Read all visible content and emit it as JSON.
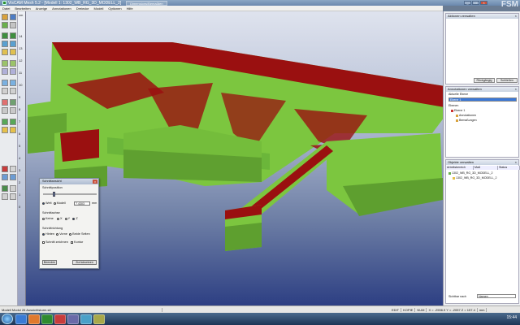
{
  "window": {
    "title": "VisCAM Mesh 5.2 - [Modell 1: 1302_WB_RG_3D_MODELL_2]",
    "tab_hint": "Dimensions/Bemaßten",
    "logo": "FSM"
  },
  "menu": [
    "Datei",
    "Bearbeiten",
    "Anzeige",
    "Annotationen",
    "Dreiecke",
    "Modell",
    "Optionen",
    "Hilfe"
  ],
  "ruler": {
    "unit": "cm",
    "ticks": [
      "14",
      "13",
      "12",
      "11",
      "10",
      "9",
      "8",
      "7",
      "6",
      "5",
      "4",
      "3",
      "2",
      "1",
      "0"
    ]
  },
  "section_dialog": {
    "title": "Schnittansicht",
    "position_label": "Schnittposition",
    "ref_welt": "Welt",
    "ref_modell": "Modell",
    "value": "7.4303",
    "unit": "mm",
    "axis_label": "Schnittachse",
    "axis_keine": "Keine",
    "axis_x": "X",
    "axis_y": "Y",
    "axis_z": "Z",
    "direction_label": "Schnittrichtung",
    "dir_hinten": "Hinten",
    "dir_vorne": "Vorne",
    "dir_beide": "Beide Seiten",
    "opt_schnitt": "Schnitt zeichnen",
    "opt_kontur": "Kontur",
    "btn_beenden": "Beenden",
    "btn_zuruecksetzen": "Zurücksetzen"
  },
  "actions_panel": {
    "title": "Aktionen verwalten",
    "btn_rueckgaengig": "Rückgängig",
    "btn_schliessen": "Schließen"
  },
  "annotations_panel": {
    "title": "Annotationen verwalten",
    "current_layer_label": "Aktuelle Ebene",
    "current_layer_value": "Ebene 1",
    "layers_label": "Ebenen",
    "tree": [
      "Ebene 1",
      "Annotationen",
      "Bemaßungen"
    ]
  },
  "objects_panel": {
    "title": "Objekte verwalten",
    "col_name": "Arbeitsbereich",
    "col_dim": "Maß",
    "col_status": "Status",
    "tree": [
      "1302_WB_RG_3D_MODELL_2",
      "1302_WB_RG_3D_MODELL_2"
    ],
    "footer_label": "Sichtbar nach",
    "footer_value": "Namen"
  },
  "status": {
    "left": "Modell Modul 26 Aussichtsturm.stl",
    "mode": "EDIT",
    "kopie": "KOPIE",
    "num": "NUM",
    "coords": "X = -2556.9  Y = -2057  Z = 157.4",
    "unit": "mm"
  },
  "taskbar": {
    "clock": "15:44"
  },
  "colors": {
    "model_green": "#7cc63f",
    "model_red": "#9a1010",
    "viewport_top": "#dfe3ee",
    "viewport_bottom": "#2d3f83"
  }
}
